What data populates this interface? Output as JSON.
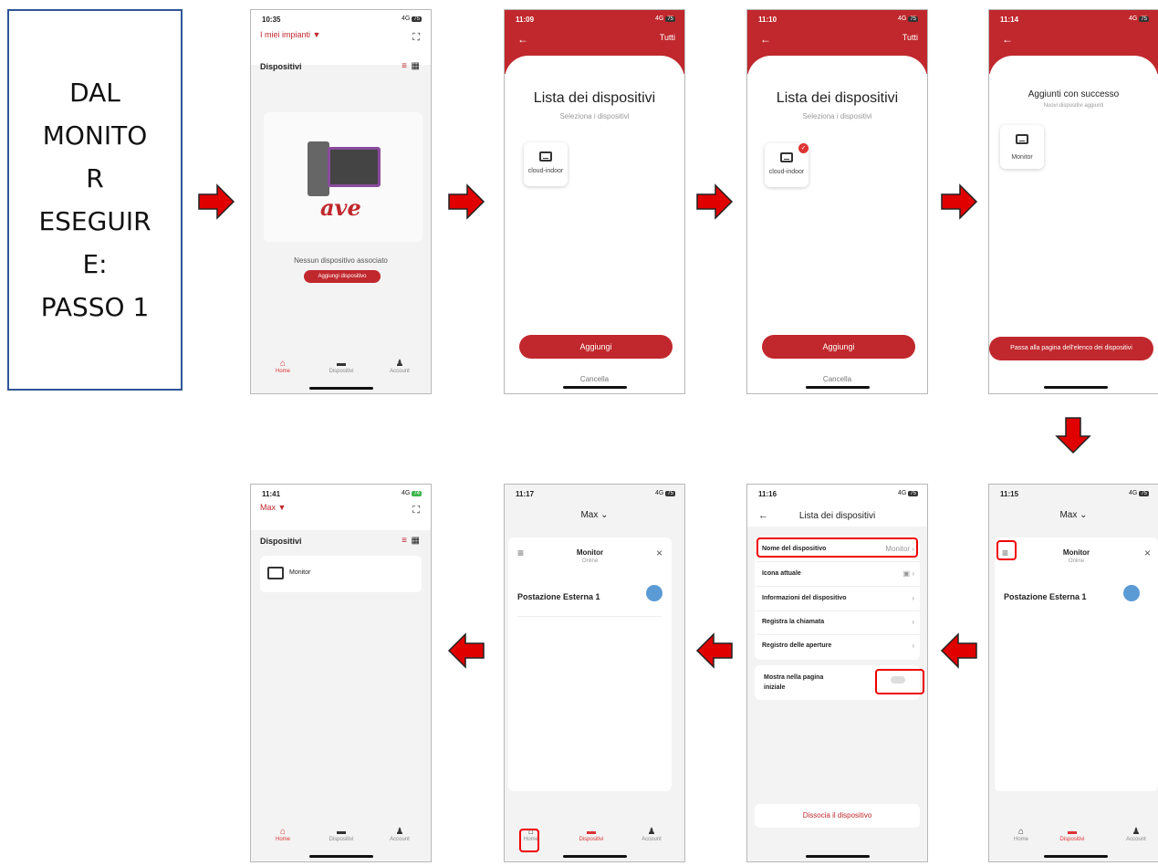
{
  "intro": {
    "lines": [
      "DAL",
      "MONITO",
      "R",
      "ESEGUIR",
      "E:",
      "PASSO 1"
    ]
  },
  "colors": {
    "accent": "#c0282d",
    "arrow": "#e00000",
    "online": "#5b9bd5"
  },
  "s1": {
    "time": "10:35",
    "signal": "4G",
    "battery": "75",
    "title": "I miei impianti",
    "section": "Dispositivi",
    "brand": "ave",
    "empty": "Nessun dispositivo associato",
    "add": "Aggiungi dispositivo",
    "nav": [
      "Home",
      "Dispositivi",
      "Account"
    ]
  },
  "s2": {
    "time": "11:09",
    "signal": "4G",
    "battery": "75",
    "tutti": "Tutti",
    "title": "Lista dei dispositivi",
    "sub": "Seleziona i dispositivi",
    "device": "cloud-indoor",
    "add": "Aggiungi",
    "cancel": "Cancella"
  },
  "s3": {
    "time": "11:10",
    "signal": "4G",
    "battery": "75",
    "tutti": "Tutti",
    "title": "Lista dei dispositivi",
    "sub": "Seleziona i dispositivi",
    "device": "cloud-indoor",
    "add": "Aggiungi",
    "cancel": "Cancella"
  },
  "s4": {
    "time": "11:14",
    "signal": "4G",
    "battery": "75",
    "title": "Aggiunti con successo",
    "sub": "Nuovi dispositivi aggiunti",
    "device": "Monitor",
    "go": "Passa alla pagina dell'elenco dei dispositivi"
  },
  "s5": {
    "time": "11:15",
    "signal": "4G",
    "battery": "75",
    "user": "Max",
    "card_title": "Monitor",
    "card_status": "Online",
    "external": "Postazione Esterna  1",
    "nav": [
      "Home",
      "Dispositivi",
      "Account"
    ]
  },
  "s6": {
    "time": "11:16",
    "signal": "4G",
    "battery": "75",
    "title": "Lista dei dispositivi",
    "rows": [
      "Nome del dispositivo",
      "Icona attuale",
      "Informazioni del dispositivo",
      "Registra la chiamata",
      "Registro delle aperture"
    ],
    "name_value": "Monitor",
    "show_line1": "Mostra nella pagina",
    "show_line2": "iniziale",
    "dissocia": "Dissocia il dispositivo"
  },
  "s7": {
    "time": "11:17",
    "signal": "4G",
    "battery": "75",
    "user": "Max",
    "card_title": "Monitor",
    "card_status": "Online",
    "external": "Postazione Esterna  1",
    "nav": [
      "Home",
      "Dispositivi",
      "Account"
    ]
  },
  "s8": {
    "time": "11:41",
    "signal": "4G",
    "battery": "74",
    "title": "Max",
    "section": "Dispositivi",
    "device": "Monitor",
    "nav": [
      "Home",
      "Dispositivi",
      "Account"
    ]
  }
}
